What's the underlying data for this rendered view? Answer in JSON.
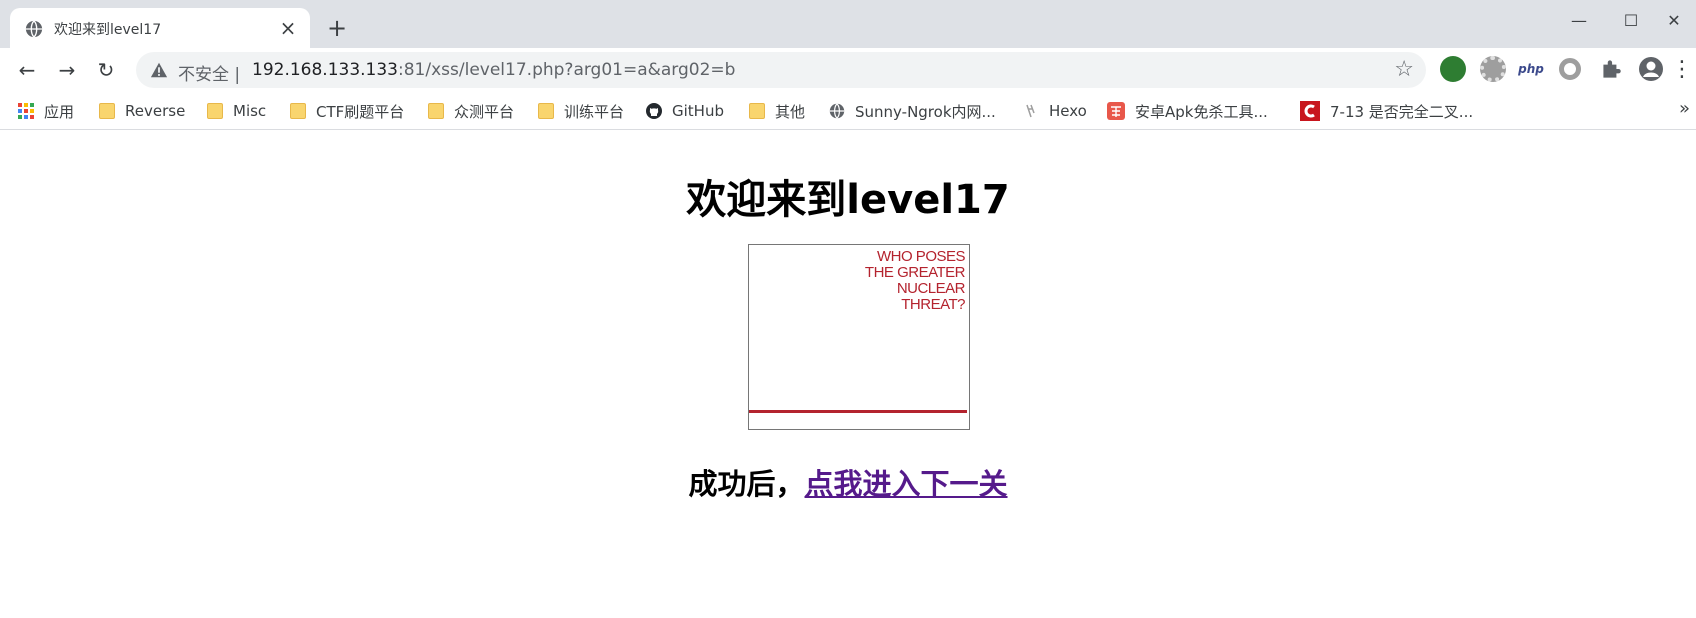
{
  "tab": {
    "title": "欢迎来到level17",
    "close_glyph": "×",
    "new_tab_glyph": "+"
  },
  "window_controls": {
    "minimize": "—",
    "maximize": "☐",
    "close": "✕"
  },
  "toolbar": {
    "back": "←",
    "forward": "→",
    "reload": "↻",
    "security_label": "不安全",
    "separator": "|",
    "url_host": "192.168.133.133",
    "url_rest": ":81/xss/level17.php?arg01=a&arg02=b",
    "star": "☆",
    "ext_php_label": "php",
    "menu": "⋮"
  },
  "bookmarks": [
    {
      "label": "应用",
      "icon": "apps-grid-icon"
    },
    {
      "label": "Reverse",
      "icon": "folder-icon"
    },
    {
      "label": "Misc",
      "icon": "folder-icon"
    },
    {
      "label": "CTF刷题平台",
      "icon": "folder-icon"
    },
    {
      "label": "众测平台",
      "icon": "folder-icon"
    },
    {
      "label": "训练平台",
      "icon": "folder-icon"
    },
    {
      "label": "GitHub",
      "icon": "github-icon"
    },
    {
      "label": "其他",
      "icon": "folder-icon"
    },
    {
      "label": "Sunny-Ngrok内网...",
      "icon": "globe-icon"
    },
    {
      "label": "Hexo",
      "icon": "hexo-icon"
    },
    {
      "label": "安卓Apk免杀工具...",
      "icon": "jianshu-icon"
    },
    {
      "label": "7-13 是否完全二叉...",
      "icon": "csdn-icon"
    }
  ],
  "bookmarks_more": "»",
  "page": {
    "heading": "欢迎来到level17",
    "poster_lines": [
      "WHO POSES",
      "THE GREATER",
      "NUCLEAR",
      "THREAT?"
    ],
    "result_prefix": "成功后，",
    "next_link": "点我进入下一关"
  },
  "colors": {
    "poster_red": "#b4232e",
    "visited_link": "#551a8b"
  }
}
